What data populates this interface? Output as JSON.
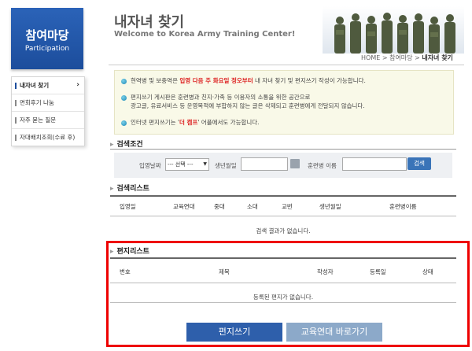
{
  "sidebar": {
    "title": "참여마당",
    "subtitle": "Participation",
    "items": [
      {
        "label": "내자녀 찾기",
        "chevron": "›"
      },
      {
        "label": "면회후기 나눔"
      },
      {
        "label": "자주 묻는 질문"
      },
      {
        "label": "자대배치조회(수료 후)"
      }
    ]
  },
  "header": {
    "title": "내자녀 찾기",
    "subtitle": "Welcome to Korea Army Training Center!"
  },
  "breadcrumb": {
    "home": "HOME",
    "sep1": " > ",
    "parent": "참여마당",
    "sep2": " > ",
    "current": "내자녀 찾기"
  },
  "notice": {
    "line1_pre": "현역병 및 보충역은 ",
    "line1_red": "입영 다음 주 화요일 정오부터",
    "line1_post": " 내 자녀 찾기 및 편지쓰기 작성이 가능합니다.",
    "line2a": "편지쓰기 게시판은 훈련병과 친지·가족 등 이용자의 소통을 위한 공간으로",
    "line2b": "광고글, 유료서비스 등 운영목적에 부합하지 않는 글은 삭제되고 훈련병에게 전달되지 않습니다.",
    "line3_pre": "인터넷 편지쓰기는 '",
    "line3_red": "더 캠프",
    "line3_post": "' 어플에서도 가능합니다."
  },
  "search": {
    "section_title": "검색조건",
    "enlist_date_label": "입영날짜",
    "enlist_date_value": "--- 선택 ---",
    "birth_label": "생년월일",
    "birth_value": "",
    "name_label": "훈련병 이름",
    "name_value": "",
    "button": "검색"
  },
  "search_list": {
    "section_title": "검색리스트",
    "columns": [
      "입영일",
      "교육연대",
      "중대",
      "소대",
      "교번",
      "생년월일",
      "훈련병이름"
    ],
    "empty": "검색 결과가 없습니다."
  },
  "letter_list": {
    "section_title": "편지리스트",
    "columns": [
      "번호",
      "제목",
      "작성자",
      "등록일",
      "상태"
    ],
    "empty": "등록된 편지가 없습니다."
  },
  "actions": {
    "write": "편지쓰기",
    "goto_regiment": "교육연대 바로가기"
  },
  "colors": {
    "brand_blue": "#1c4d9c",
    "accent_red": "#dd2222",
    "highlight_frame": "#ee0000"
  }
}
